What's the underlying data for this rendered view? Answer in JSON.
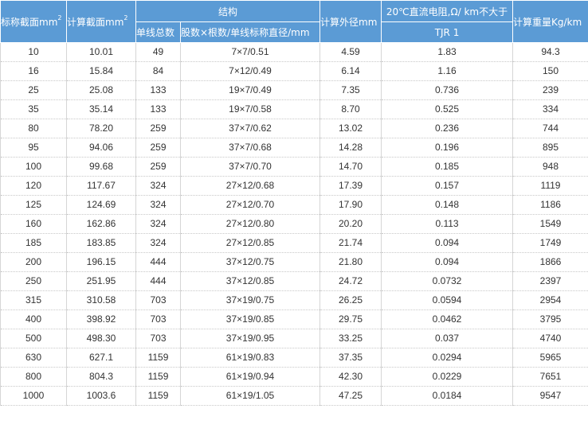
{
  "headers": {
    "nominal_area": "标称截面mm",
    "nominal_area_sup": "2",
    "calc_area": "计算截面mm",
    "calc_area_sup": "2",
    "structure": "结构",
    "strand_total": "单线总数",
    "strand_detail": "股数×根数/单线标称直径/mm",
    "outer_diameter": "计算外径mm",
    "resistance": "20℃直流电阻,Ω/ km不大于",
    "resistance_sub": "TJR 1",
    "weight": "计算重量Kg/km"
  },
  "rows": [
    [
      "10",
      "10.01",
      "49",
      "7×7/0.51",
      "4.59",
      "1.83",
      "94.3"
    ],
    [
      "16",
      "15.84",
      "84",
      "7×12/0.49",
      "6.14",
      "1.16",
      "150"
    ],
    [
      "25",
      "25.08",
      "133",
      "19×7/0.49",
      "7.35",
      "0.736",
      "239"
    ],
    [
      "35",
      "35.14",
      "133",
      "19×7/0.58",
      "8.70",
      "0.525",
      "334"
    ],
    [
      "80",
      "78.20",
      "259",
      "37×7/0.62",
      "13.02",
      "0.236",
      "744"
    ],
    [
      "95",
      "94.06",
      "259",
      "37×7/0.68",
      "14.28",
      "0.196",
      "895"
    ],
    [
      "100",
      "99.68",
      "259",
      "37×7/0.70",
      "14.70",
      "0.185",
      "948"
    ],
    [
      "120",
      "117.67",
      "324",
      "27×12/0.68",
      "17.39",
      "0.157",
      "1119"
    ],
    [
      "125",
      "124.69",
      "324",
      "27×12/0.70",
      "17.90",
      "0.148",
      "1186"
    ],
    [
      "160",
      "162.86",
      "324",
      "27×12/0.80",
      "20.20",
      "0.113",
      "1549"
    ],
    [
      "185",
      "183.85",
      "324",
      "27×12/0.85",
      "21.74",
      "0.094",
      "1749"
    ],
    [
      "200",
      "196.15",
      "444",
      "37×12/0.75",
      "21.80",
      "0.094",
      "1866"
    ],
    [
      "250",
      "251.95",
      "444",
      "37×12/0.85",
      "24.72",
      "0.0732",
      "2397"
    ],
    [
      "315",
      "310.58",
      "703",
      "37×19/0.75",
      "26.25",
      "0.0594",
      "2954"
    ],
    [
      "400",
      "398.92",
      "703",
      "37×19/0.85",
      "29.75",
      "0.0462",
      "3795"
    ],
    [
      "500",
      "498.30",
      "703",
      "37×19/0.95",
      "33.25",
      "0.037",
      "4740"
    ],
    [
      "630",
      "627.1",
      "1159",
      "61×19/0.83",
      "37.35",
      "0.0294",
      "5965"
    ],
    [
      "800",
      "804.3",
      "1159",
      "61×19/0.94",
      "42.30",
      "0.0229",
      "7651"
    ],
    [
      "1000",
      "1003.6",
      "1159",
      "61×19/1.05",
      "47.25",
      "0.0184",
      "9547"
    ]
  ]
}
